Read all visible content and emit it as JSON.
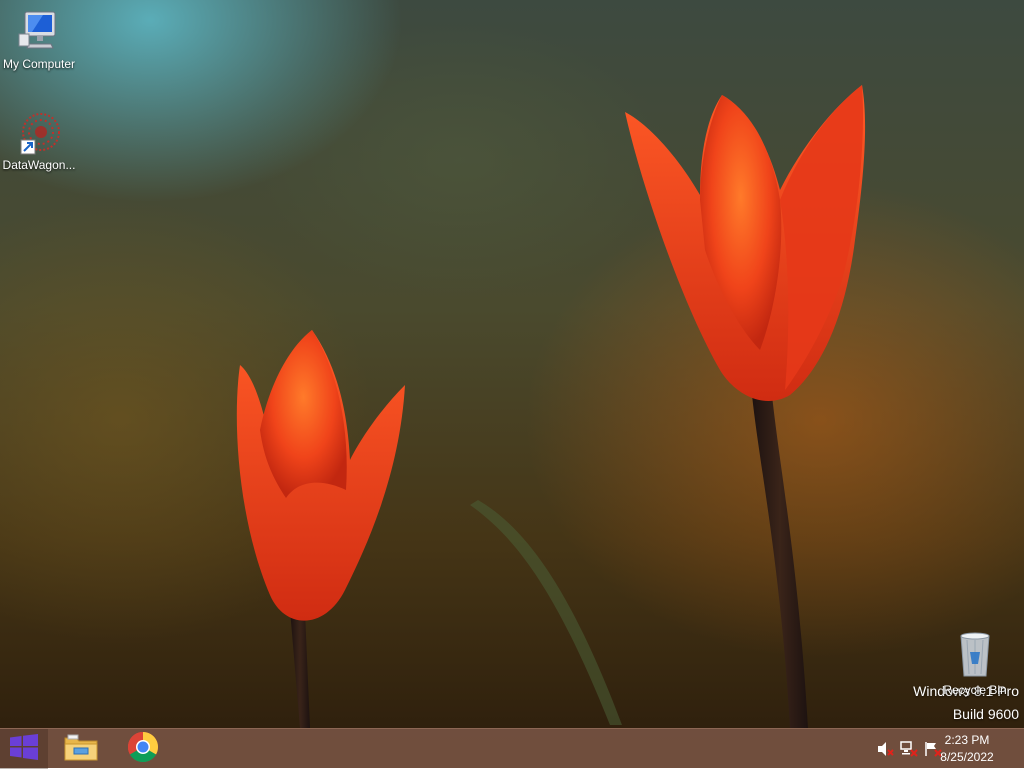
{
  "desktop": {
    "icons": [
      {
        "label": "My Computer",
        "icon": "computer-icon"
      },
      {
        "label": "DataWagon...",
        "icon": "datawagon-icon"
      },
      {
        "label": "Recycle Bin",
        "icon": "recycle-bin-icon"
      }
    ],
    "watermark": {
      "line1": "Windows 8.1 Pro",
      "line2": "Build 9600"
    }
  },
  "taskbar": {
    "pinned": [
      {
        "name": "File Explorer",
        "icon": "folder-icon"
      },
      {
        "name": "Google Chrome",
        "icon": "chrome-icon"
      }
    ],
    "tray": {
      "icons": [
        "speaker-muted-icon",
        "network-error-icon",
        "action-center-flag-icon"
      ],
      "time": "2:23 PM",
      "date": "8/25/2022"
    }
  },
  "colors": {
    "taskbar": "#765242",
    "start_accent": "#6a3fd6",
    "tulip": "#f0441a"
  }
}
